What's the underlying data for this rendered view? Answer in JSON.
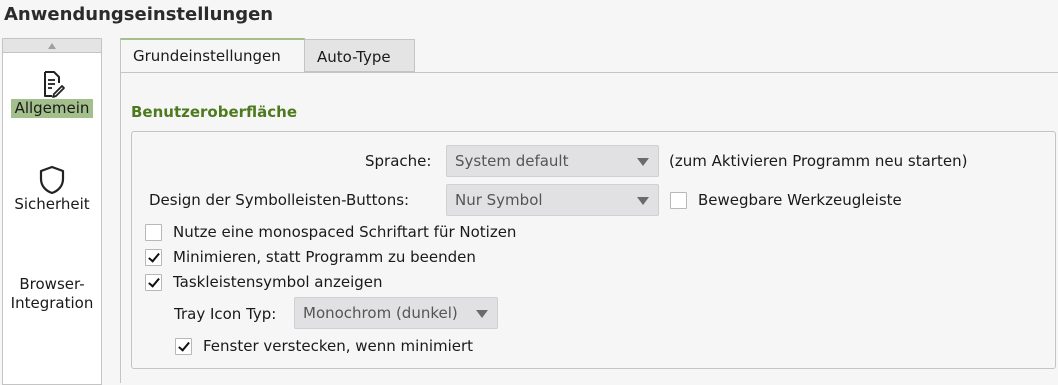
{
  "page_title": "Anwendungseinstellungen",
  "sidebar": {
    "items": [
      {
        "label": "Allgemein",
        "icon": "document-edit-icon",
        "active": true
      },
      {
        "label": "Sicherheit",
        "icon": "shield-icon",
        "active": false
      },
      {
        "label_line1": "Browser-",
        "label_line2": "Integration",
        "active": false
      }
    ]
  },
  "tabs": [
    {
      "label": "Grundeinstellungen",
      "active": true
    },
    {
      "label": "Auto-Type",
      "active": false
    }
  ],
  "section": {
    "title": "Benutzeroberfläche",
    "language_label": "Sprache:",
    "language_value": "System default",
    "language_hint": "(zum Aktivieren Programm neu starten)",
    "toolbar_style_label": "Design der Symbolleisten-Buttons:",
    "toolbar_style_value": "Nur Symbol",
    "movable_toolbar_label": "Bewegbare Werkzeugleiste",
    "movable_toolbar_checked": false,
    "monospace_notes_label": "Nutze eine monospaced Schriftart für Notizen",
    "monospace_notes_checked": false,
    "minimize_instead_label": "Minimieren, statt Programm zu beenden",
    "minimize_instead_checked": true,
    "tray_icon_label": "Taskleistensymbol anzeigen",
    "tray_icon_checked": true,
    "tray_icon_type_label": "Tray Icon Typ:",
    "tray_icon_type_value": "Monochrom (dunkel)",
    "hide_window_label": "Fenster verstecken, wenn minimiert",
    "hide_window_checked": true
  }
}
